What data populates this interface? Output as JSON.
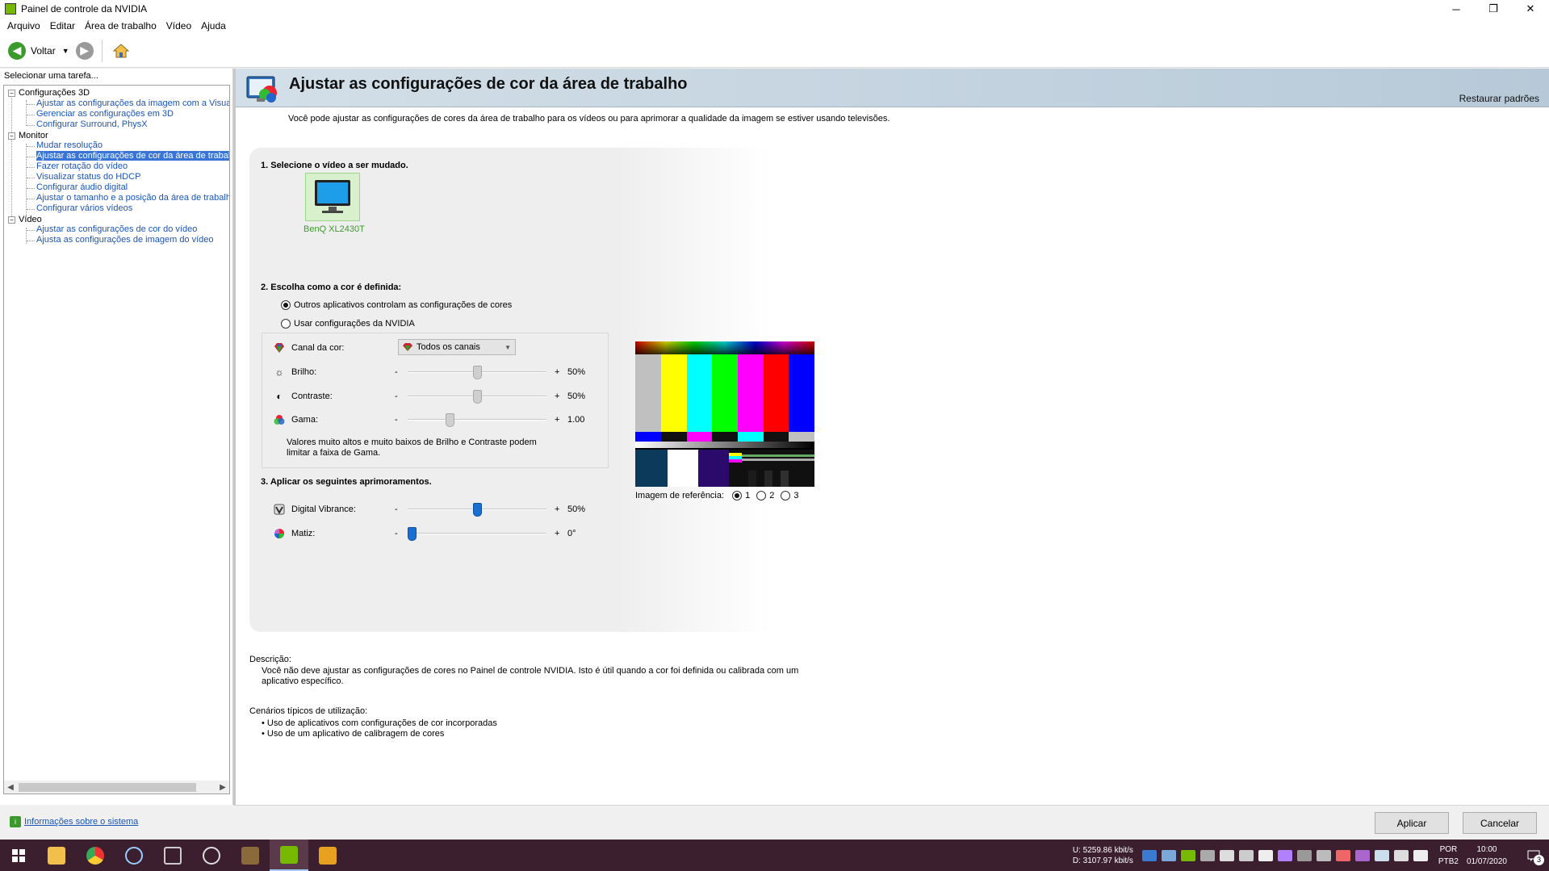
{
  "window": {
    "title": "Painel de controle da NVIDIA",
    "minimize": "─",
    "restore": "❐",
    "close": "✕"
  },
  "menu": [
    "Arquivo",
    "Editar",
    "Área de trabalho",
    "Vídeo",
    "Ajuda"
  ],
  "toolbar": {
    "back_label": "Voltar"
  },
  "sidebar": {
    "task_label": "Selecionar uma tarefa...",
    "groups": [
      {
        "label": "Configurações 3D",
        "items": [
          "Ajustar as configurações da imagem com a Visuali",
          "Gerenciar as configurações em 3D",
          "Configurar Surround, PhysX"
        ]
      },
      {
        "label": "Monitor",
        "items": [
          "Mudar resolução",
          "Ajustar as configurações de cor da área de trabal",
          "Fazer rotação do vídeo",
          "Visualizar status do HDCP",
          "Configurar áudio digital",
          "Ajustar o tamanho e a posição da área de trabalh",
          "Configurar vários vídeos"
        ]
      },
      {
        "label": "Vídeo",
        "items": [
          "Ajustar as configurações de cor do vídeo",
          "Ajusta as configurações de imagem do vídeo"
        ]
      }
    ],
    "system_info": "Informações sobre o sistema"
  },
  "main": {
    "title": "Ajustar as configurações de cor da área de trabalho",
    "restore_defaults": "Restaurar padrões",
    "intro": "Você pode ajustar as configurações de cores da área de trabalho para os vídeos ou para aprimorar a qualidade da imagem se estiver usando televisões.",
    "step1": "1. Selecione o vídeo a ser mudado.",
    "monitor_name": "BenQ XL2430T",
    "step2": "2. Escolha como a cor é definida:",
    "radio_other": "Outros aplicativos controlam as configurações de cores",
    "radio_nvidia": "Usar configurações da NVIDIA",
    "channel_label": "Canal da cor:",
    "channel_value": "Todos os canais",
    "brightness": {
      "label": "Brilho:",
      "value": "50%",
      "level": 0.5
    },
    "contrast": {
      "label": "Contraste:",
      "value": "50%",
      "level": 0.5
    },
    "gamma": {
      "label": "Gama:",
      "value": "1.00",
      "level": 0.29
    },
    "warning": "Valores muito altos e muito baixos de Brilho e Contraste podem limitar a faixa de Gama.",
    "step3": "3. Aplicar os seguintes aprimoramentos.",
    "vibrance": {
      "label": "Digital Vibrance:",
      "value": "50%",
      "level": 0.5
    },
    "hue": {
      "label": "Matiz:",
      "value": "0°",
      "level": 0.0
    },
    "minus": "-",
    "plus": "+",
    "reference_label": "Imagem de referência:",
    "reference_options": [
      "1",
      "2",
      "3"
    ],
    "description_title": "Descrição:",
    "description_body": "Você não deve ajustar as configurações de cores no Painel de controle NVIDIA. Isto é útil quando a cor foi definida ou calibrada com um aplicativo específico.",
    "scenarios_title": "Cenários típicos de utilização:",
    "scenarios": [
      "• Uso de aplicativos com configurações de cor incorporadas",
      "• Uso de um aplicativo de calibragem de cores"
    ]
  },
  "buttons": {
    "apply": "Aplicar",
    "cancel": "Cancelar"
  },
  "taskbar": {
    "upload": "U:   5259.86 kbit/s",
    "download": "D:   3107.97 kbit/s",
    "lang1": "POR",
    "lang2": "PTB2",
    "time": "10:00",
    "date": "01/07/2020",
    "notifications": "3"
  },
  "colors": {
    "accent": "#3875d7",
    "link": "#1a55b8",
    "nvidia_green": "#76b900",
    "taskbar": "#3b1f2e"
  }
}
